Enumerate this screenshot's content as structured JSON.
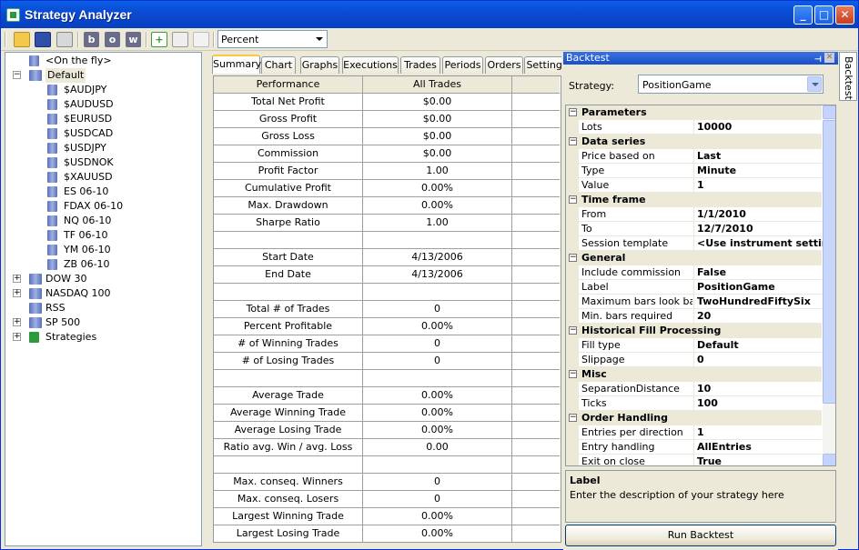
{
  "window": {
    "title": "Strategy Analyzer",
    "buttons": {
      "minimize": "_",
      "maximize": "□",
      "close": "✕"
    }
  },
  "toolbar": {
    "icons": [
      "open-icon",
      "save-icon",
      "print-icon",
      "b-icon",
      "o-icon",
      "w-icon",
      "add-icon",
      "edit-icon",
      "remove-icon"
    ],
    "b_label": "b",
    "o_label": "o",
    "w_label": "w",
    "display_select": "Percent"
  },
  "tree": {
    "items": [
      {
        "label": "<On the fly>",
        "icon": "instrument-list-icon"
      },
      {
        "label": "Default",
        "icon": "instrument-list-icon",
        "expanded": true,
        "selected": true
      },
      {
        "label": "$AUDJPY",
        "icon": "instrument-icon"
      },
      {
        "label": "$AUDUSD",
        "icon": "instrument-icon"
      },
      {
        "label": "$EURUSD",
        "icon": "instrument-icon"
      },
      {
        "label": "$USDCAD",
        "icon": "instrument-icon"
      },
      {
        "label": "$USDJPY",
        "icon": "instrument-icon"
      },
      {
        "label": "$USDNOK",
        "icon": "instrument-icon"
      },
      {
        "label": "$XAUUSD",
        "icon": "instrument-icon"
      },
      {
        "label": "ES 06-10",
        "icon": "instrument-icon"
      },
      {
        "label": "FDAX 06-10",
        "icon": "instrument-icon"
      },
      {
        "label": "NQ 06-10",
        "icon": "instrument-icon"
      },
      {
        "label": "TF 06-10",
        "icon": "instrument-icon"
      },
      {
        "label": "YM 06-10",
        "icon": "instrument-icon"
      },
      {
        "label": "ZB 06-10",
        "icon": "instrument-icon"
      },
      {
        "label": "DOW 30",
        "icon": "instrument-list-icon",
        "expanded": false
      },
      {
        "label": "NASDAQ 100",
        "icon": "instrument-list-icon",
        "expanded": false
      },
      {
        "label": "RSS",
        "icon": "instrument-list-icon"
      },
      {
        "label": "SP 500",
        "icon": "instrument-list-icon",
        "expanded": false
      },
      {
        "label": "Strategies",
        "icon": "strategies-icon",
        "expanded": false
      }
    ]
  },
  "tabs": [
    "Summary",
    "Chart",
    "Graphs",
    "Executions",
    "Trades",
    "Periods",
    "Orders",
    "Settings"
  ],
  "performance": {
    "headers": [
      "Performance",
      "All Trades",
      ""
    ],
    "rows": [
      [
        "Total Net Profit",
        "$0.00"
      ],
      [
        "Gross Profit",
        "$0.00"
      ],
      [
        "Gross Loss",
        "$0.00"
      ],
      [
        "Commission",
        "$0.00"
      ],
      [
        "Profit Factor",
        "1.00"
      ],
      [
        "Cumulative Profit",
        "0.00%"
      ],
      [
        "Max. Drawdown",
        "0.00%"
      ],
      [
        "Sharpe Ratio",
        "1.00"
      ],
      [
        "",
        ""
      ],
      [
        "Start Date",
        "4/13/2006"
      ],
      [
        "End Date",
        "4/13/2006"
      ],
      [
        "",
        ""
      ],
      [
        "Total # of Trades",
        "0"
      ],
      [
        "Percent Profitable",
        "0.00%"
      ],
      [
        "# of Winning Trades",
        "0"
      ],
      [
        "# of Losing Trades",
        "0"
      ],
      [
        "",
        ""
      ],
      [
        "Average Trade",
        "0.00%"
      ],
      [
        "Average Winning Trade",
        "0.00%"
      ],
      [
        "Average Losing Trade",
        "0.00%"
      ],
      [
        "Ratio avg. Win / avg. Loss",
        "0.00"
      ],
      [
        "",
        ""
      ],
      [
        "Max. conseq. Winners",
        "0"
      ],
      [
        "Max. conseq. Losers",
        "0"
      ],
      [
        "Largest Winning Trade",
        "0.00%"
      ],
      [
        "Largest Losing Trade",
        "0.00%"
      ]
    ]
  },
  "backtest": {
    "panel_title": "Backtest",
    "side_tab": "Backtest",
    "strategy_label": "Strategy:",
    "strategy_value": "PositionGame",
    "properties": [
      {
        "category": "Parameters",
        "items": [
          [
            "Lots",
            "10000"
          ]
        ]
      },
      {
        "category": "Data series",
        "items": [
          [
            "Price based on",
            "Last"
          ],
          [
            "Type",
            "Minute"
          ],
          [
            "Value",
            "1"
          ]
        ]
      },
      {
        "category": "Time frame",
        "items": [
          [
            "From",
            "1/1/2010"
          ],
          [
            "To",
            "12/7/2010"
          ],
          [
            "Session template",
            "<Use instrument settings>"
          ]
        ]
      },
      {
        "category": "General",
        "items": [
          [
            "Include commission",
            "False"
          ],
          [
            "Label",
            "PositionGame"
          ],
          [
            "Maximum bars look back",
            "TwoHundredFiftySix"
          ],
          [
            "Min. bars required",
            "20"
          ]
        ]
      },
      {
        "category": "Historical Fill Processing",
        "items": [
          [
            "Fill type",
            "Default"
          ],
          [
            "Slippage",
            "0"
          ]
        ]
      },
      {
        "category": "Misc",
        "items": [
          [
            "SeparationDistance",
            "10"
          ],
          [
            "Ticks",
            "100"
          ]
        ]
      },
      {
        "category": "Order Handling",
        "items": [
          [
            "Entries per direction",
            "1"
          ],
          [
            "Entry handling",
            "AllEntries"
          ],
          [
            "Exit on close",
            "True"
          ]
        ]
      }
    ],
    "description_title": "Label",
    "description_text": "Enter the description of your strategy here",
    "run_button": "Run Backtest"
  }
}
